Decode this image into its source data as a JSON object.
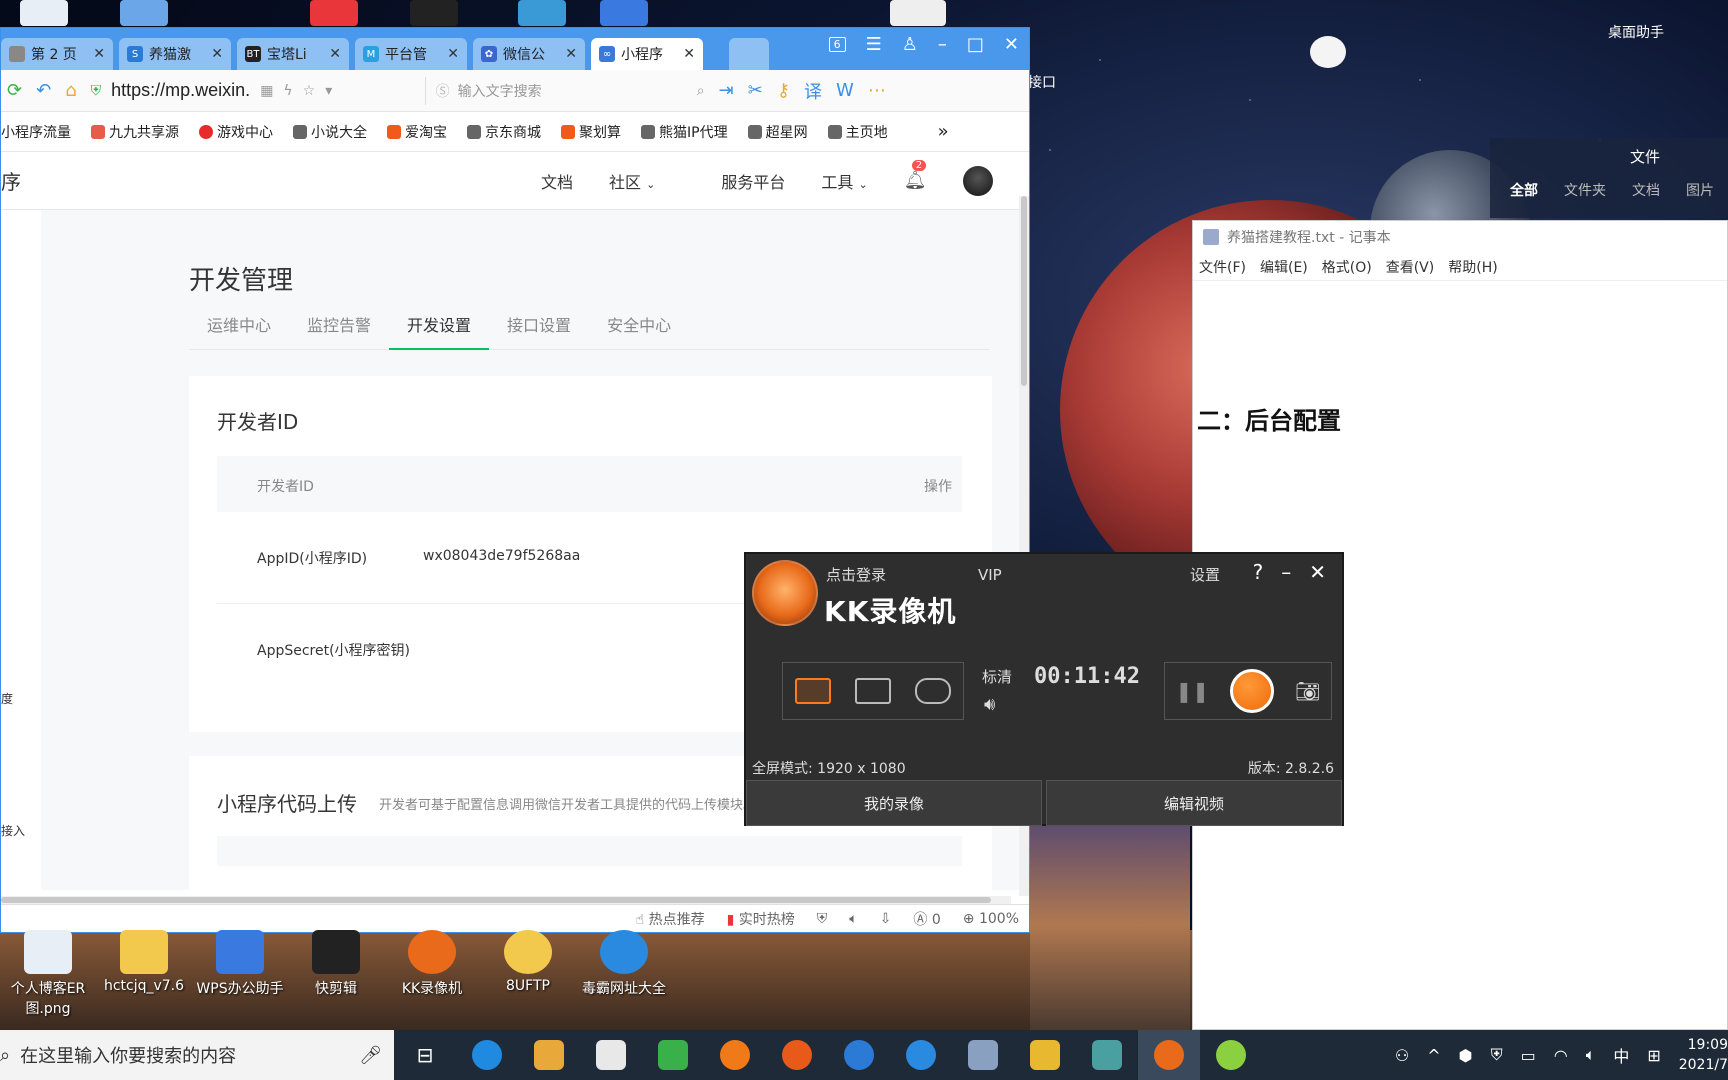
{
  "desktop": {
    "assistant_label": "桌面助手",
    "side_label": "接口",
    "colors": {
      "accent": "#4a98ec",
      "wechat_green": "#07c160",
      "kk_orange": "#f06a08"
    }
  },
  "browser": {
    "tabs": [
      {
        "label": "第 2 页",
        "icon": "page-icon",
        "color": "#888888"
      },
      {
        "label": "养猫激",
        "icon": "s-icon",
        "color": "#2a7ad6"
      },
      {
        "label": "宝塔Li",
        "icon": "bt-icon",
        "color": "#222222"
      },
      {
        "label": "平台管",
        "icon": "m-icon",
        "color": "#2aa0e0"
      },
      {
        "label": "微信公",
        "icon": "paw-icon",
        "color": "#3a66d0"
      },
      {
        "label": "小程序",
        "icon": "link-icon",
        "color": "#3a7ad6",
        "active": true
      }
    ],
    "tab_count": "6",
    "url": "https://mp.weixin.",
    "search_placeholder": "输入文字搜索",
    "bookmarks": [
      "小程序流量",
      "九九共享源",
      "游戏中心",
      "小说大全",
      "爱淘宝",
      "京东商城",
      "聚划算",
      "熊猫IP代理",
      "超星网",
      "主页地"
    ],
    "status": {
      "hot": "热点推荐",
      "realtime": "实时热榜",
      "blocked": "0",
      "zoom": "100%"
    }
  },
  "wechat": {
    "left_label": "序",
    "nav": [
      "文档",
      "社区",
      "服务平台",
      "工具"
    ],
    "bell_count": "2",
    "page_title": "开发管理",
    "subtabs": [
      "运维中心",
      "监控告警",
      "开发设置",
      "接口设置",
      "安全中心"
    ],
    "active_subtab": 2,
    "dev_card": {
      "title": "开发者ID",
      "col_id": "开发者ID",
      "col_op": "操作",
      "rows": [
        {
          "label": "AppID(小程序ID)",
          "value": "wx08043de79f5268aa"
        },
        {
          "label": "AppSecret(小程序密钥)",
          "value": ""
        }
      ]
    },
    "upload_card": {
      "title": "小程序代码上传",
      "desc": "开发者可基于配置信息调用微信开发者工具提供的代码上传模块。查看详情"
    },
    "side_snips": [
      "度",
      "接入"
    ]
  },
  "notepad": {
    "title": "养猫搭建教程.txt - 记事本",
    "menu": [
      "文件(F)",
      "编辑(E)",
      "格式(O)",
      "查看(V)",
      "帮助(H)"
    ],
    "body": "二：后台配置"
  },
  "filepanel": {
    "title": "文件",
    "tabs": [
      "全部",
      "文件夹",
      "文档",
      "图片"
    ]
  },
  "kk": {
    "login": "点击登录",
    "vip": "VIP",
    "brand": "KK录像机",
    "settings": "设置",
    "quality": "标清",
    "timer": "00:11:42",
    "resolution": "全屏模式: 1920 x 1080",
    "version": "版本: 2.8.2.6",
    "my_videos": "我的录像",
    "edit_video": "编辑视频"
  },
  "desktop_icons": [
    {
      "label": "个人博客ER图.png",
      "color": "#e8eef6"
    },
    {
      "label": "hctcjq_v7.6",
      "color": "#f2c94c"
    },
    {
      "label": "WPS办公助手",
      "color": "#3a7ae0"
    },
    {
      "label": "快剪辑",
      "color": "#222222"
    },
    {
      "label": "KK录像机",
      "color": "#e86a1a"
    },
    {
      "label": "8UFTP",
      "color": "#f2c94c"
    },
    {
      "label": "毒霸网址大全",
      "color": "#2a8ae0"
    }
  ],
  "taskbar": {
    "search_placeholder": "在这里输入你要搜索的内容",
    "apps": [
      "#1f8ae0",
      "#e8a93a",
      "#e8e8e8",
      "#3ab04a",
      "#f07a1a",
      "#e85a1a",
      "#2a7ad6",
      "#2a8ae0",
      "#8aa0c0",
      "#e8b830",
      "#4aa0a0",
      "#e86a1a",
      "#8ad040"
    ],
    "ime": "中",
    "time": "19:09",
    "date": "2021/7"
  }
}
